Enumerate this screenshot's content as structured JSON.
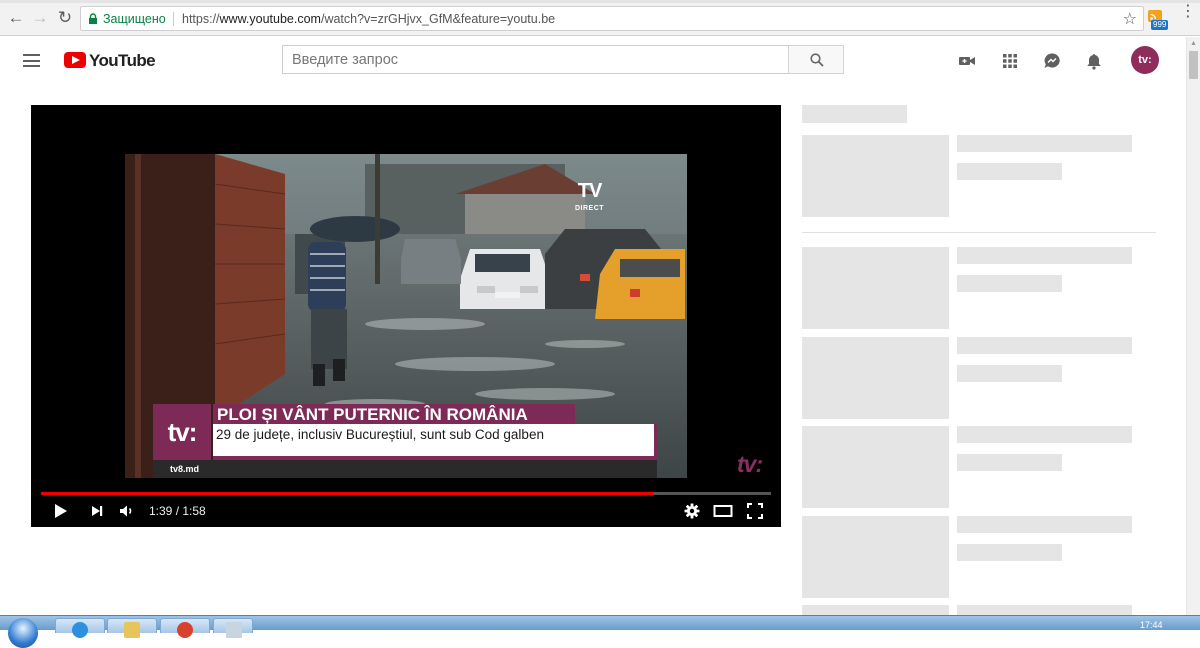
{
  "browser": {
    "secure_label": "Защищено",
    "url_scheme": "https://",
    "url_host": "www.youtube.com",
    "url_path": "/watch?v=zrGHjvx_GfM&feature=youtu.be",
    "extension_badge": "999"
  },
  "youtube": {
    "logo_text": "YouTube",
    "search_placeholder": "Введите запрос",
    "avatar_text": "tv:"
  },
  "video": {
    "channel_bug": "TV",
    "channel_bug_sub": "DIRECT",
    "logo_text": "tv:",
    "headline": "PLOI ȘI VÂNT PUTERNIC ÎN ROMÂNIA",
    "subline": "29 de județe, inclusiv Bucureștiul, sunt sub Cod galben",
    "site": "tv8.md",
    "watermark": "tv:",
    "time_display": "1:39 / 1:58",
    "progress_fraction": 0.839
  },
  "taskbar": {
    "clock": "17:44"
  },
  "colors": {
    "brand_red": "#ee0000",
    "tv8_purple": "#7e2a57",
    "secure_green": "#0b8043",
    "skeleton": "#e5e5e5"
  }
}
